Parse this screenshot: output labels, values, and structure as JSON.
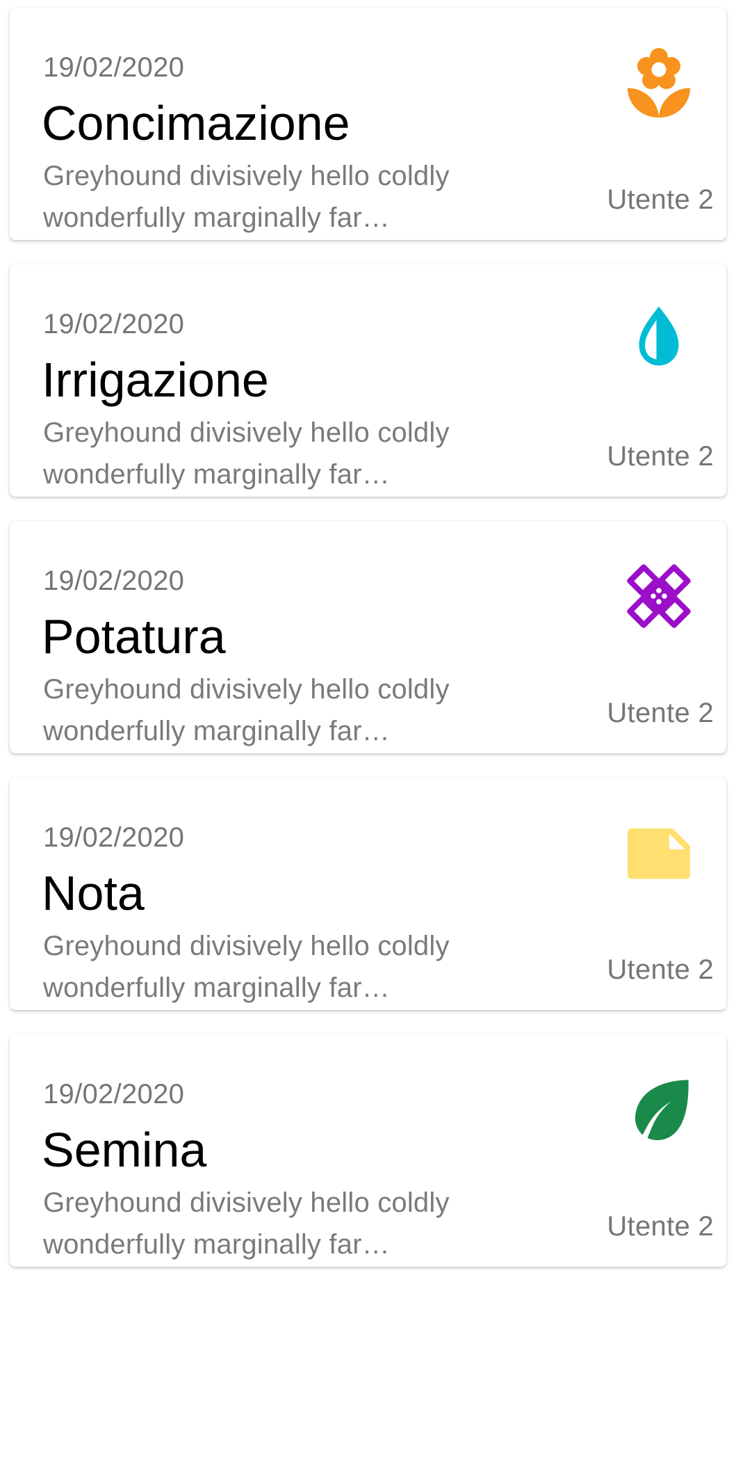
{
  "activities": [
    {
      "date": "19/02/2020",
      "title": "Concimazione",
      "description": "Greyhound divisively hello coldly\nwonderfully marginally far…",
      "user": "Utente 2",
      "icon": "flower-icon",
      "icon_color": "#F7931E"
    },
    {
      "date": "19/02/2020",
      "title": "Irrigazione",
      "description": "Greyhound divisively hello coldly\nwonderfully marginally far…",
      "user": "Utente 2",
      "icon": "water-drop-icon",
      "icon_color": "#00BCD4"
    },
    {
      "date": "19/02/2020",
      "title": "Potatura",
      "description": "Greyhound divisively hello coldly\nwonderfully marginally far…",
      "user": "Utente 2",
      "icon": "bandage-icon",
      "icon_color": "#9C0FC9"
    },
    {
      "date": "19/02/2020",
      "title": "Nota",
      "description": "Greyhound divisively hello coldly\nwonderfully marginally far…",
      "user": "Utente 2",
      "icon": "note-icon",
      "icon_color": "#FFDF70"
    },
    {
      "date": "19/02/2020",
      "title": "Semina",
      "description": "Greyhound divisively hello coldly\nwonderfully marginally far…",
      "user": "Utente 2",
      "icon": "leaf-icon",
      "icon_color": "#1A8A4A"
    }
  ]
}
